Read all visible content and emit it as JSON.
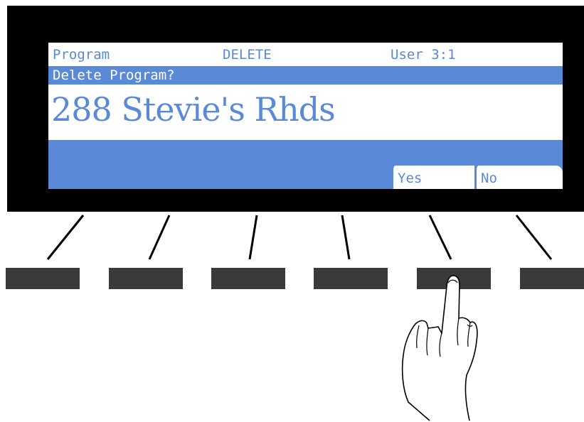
{
  "display": {
    "mode": "Program",
    "page": "DELETE",
    "bank": "User 3:1",
    "prompt": "Delete Program?",
    "program_name": "288 Stevie's Rhds",
    "soft_labels": {
      "yes": "Yes",
      "no": "No"
    }
  },
  "colors": {
    "lcd_accent": "#5a89d8",
    "bezel": "#000000",
    "soft_button": "#3a3a3a"
  },
  "icons": {
    "pointer": "pointing-hand-icon"
  }
}
